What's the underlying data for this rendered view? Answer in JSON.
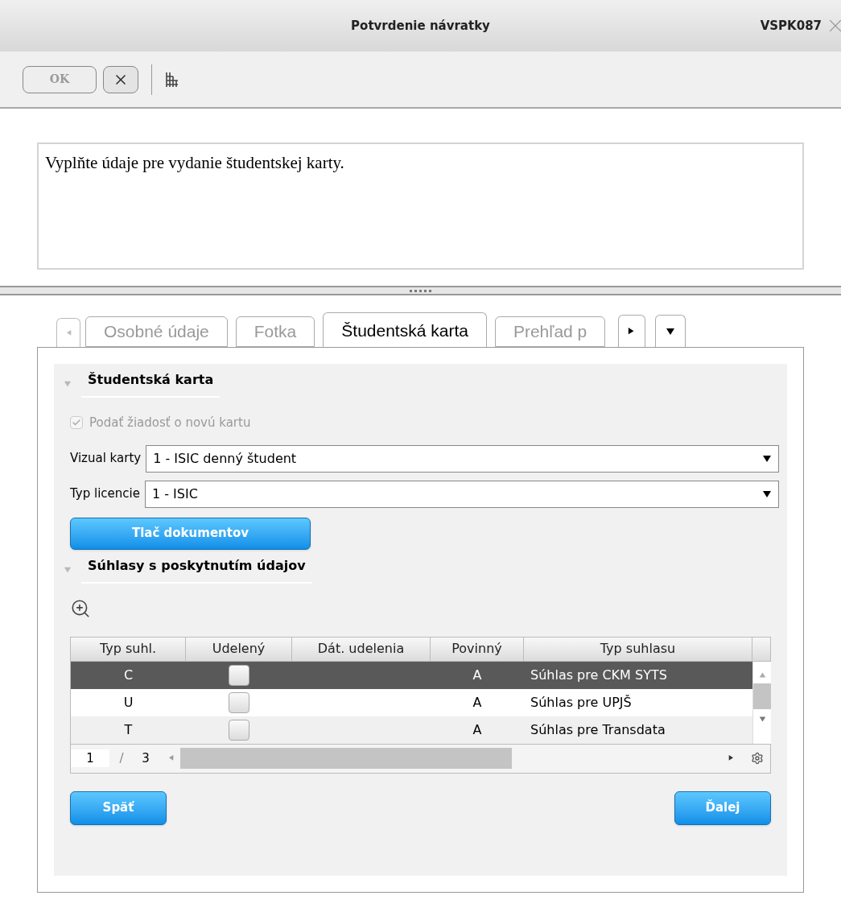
{
  "window": {
    "title": "Potvrdenie návratky",
    "code": "VSPK087"
  },
  "toolbar": {
    "ok_button": "OK",
    "ok_disabled": true
  },
  "message": "Vyplňte údaje pre vydanie študentskej karty.",
  "tabs": [
    {
      "label": "Osobné údaje",
      "selected": false
    },
    {
      "label": "Fotka",
      "selected": false
    },
    {
      "label": "Študentská karta",
      "selected": true
    },
    {
      "label": "Prehľad p",
      "selected": false
    }
  ],
  "card_section": {
    "title": "Študentská karta",
    "expanded": true,
    "checkbox": {
      "label": "Podať žiadosť o novú kartu",
      "checked": true,
      "disabled": true
    },
    "fields": [
      {
        "label": "Vizual karty",
        "value": "1 - ISIC denný študent"
      },
      {
        "label": "Typ licencie",
        "value": "1 - ISIC"
      }
    ],
    "print_button": "Tlač dokumentov"
  },
  "consent_section": {
    "title": "Súhlasy s poskytnutím údajov",
    "expanded": true,
    "table": {
      "columns": [
        "Typ suhl.",
        "Udelený",
        "Dát. udelenia",
        "Povinný",
        "Typ suhlasu"
      ],
      "rows": [
        {
          "type": "C",
          "granted": false,
          "mandatory": "A",
          "consent_type": "Súhlas pre CKM SYTS",
          "selected": true
        },
        {
          "type": "U",
          "granted": false,
          "mandatory": "A",
          "consent_type": "Súhlas pre UPJŠ",
          "selected": false
        },
        {
          "type": "T",
          "granted": false,
          "mandatory": "A",
          "consent_type": "Súhlas pre Transdata",
          "selected": false
        }
      ]
    },
    "pager": {
      "current": "1",
      "separator": "/",
      "total": "3"
    }
  },
  "buttons": {
    "back": "Späť",
    "next": "Ďalej"
  }
}
